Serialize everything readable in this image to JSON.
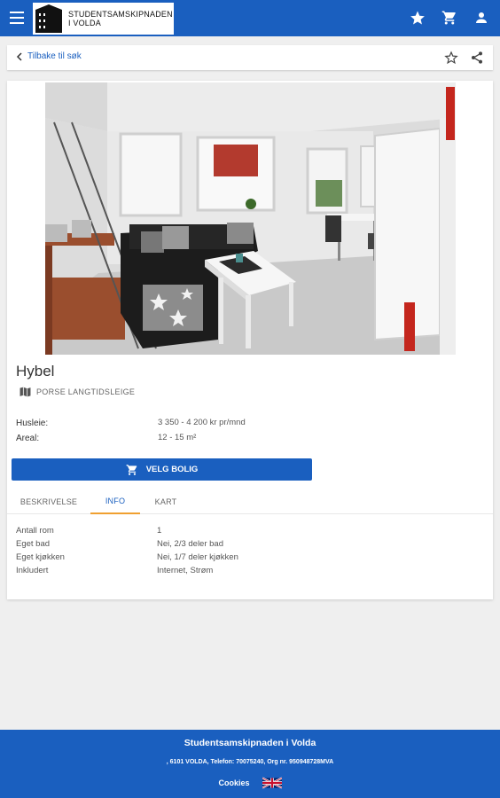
{
  "appbar": {
    "logo_line1": "STUDENTSAMSKIPNADEN",
    "logo_line2": "I VOLDA",
    "icons": [
      "menu-icon",
      "star-icon",
      "cart-icon",
      "person-icon"
    ]
  },
  "backbar": {
    "back_label": "Tilbake til søk",
    "icons": [
      "chevron-left-icon",
      "star-outline-icon",
      "share-icon"
    ]
  },
  "listing": {
    "title": "Hybel",
    "location": "PORSE LANGTIDSLEIGE",
    "properties": [
      {
        "label": "Husleie:",
        "value": "3 350 - 4 200 kr pr/mnd"
      },
      {
        "label": "Areal:",
        "value": "12 - 15 m²"
      }
    ],
    "select_button": "VELG BOLIG"
  },
  "tabs": [
    {
      "label": "BESKRIVELSE",
      "active": false
    },
    {
      "label": "INFO",
      "active": true
    },
    {
      "label": "KART",
      "active": false
    }
  ],
  "info": [
    {
      "label": "Antall rom",
      "value": "1"
    },
    {
      "label": "Eget bad",
      "value": "Nei, 2/3 deler bad"
    },
    {
      "label": "Eget kjøkken",
      "value": "Nei, 1/7 deler kjøkken"
    },
    {
      "label": "Inkludert",
      "value": "Internet, Strøm"
    }
  ],
  "footer": {
    "title": "Studentsamskipnaden i Volda",
    "contact": ", 6101 VOLDA, Telefon: 70075240, Org nr. 950948728MVA",
    "cookies": "Cookies"
  },
  "colors": {
    "primary": "#1a5fbf",
    "tab_indicator": "#f0a030",
    "page_background": "#efefef"
  }
}
